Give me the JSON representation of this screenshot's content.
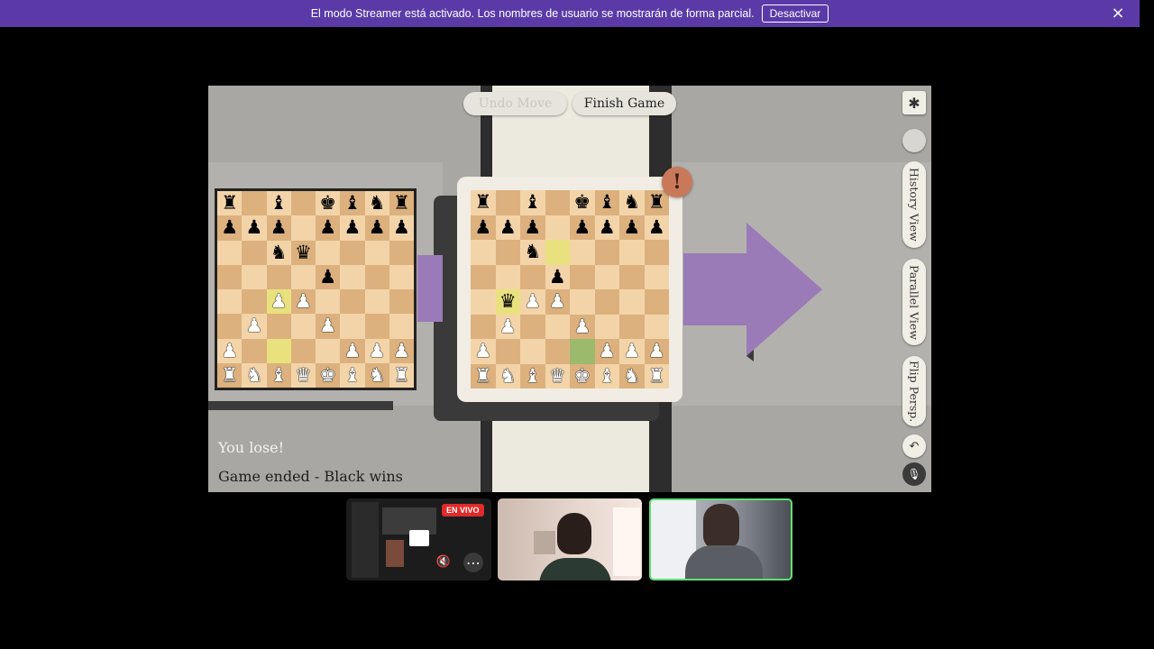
{
  "banner": {
    "text": "El modo Streamer está activado. Los nombres de usuario se mostrarán de forma parcial.",
    "button_label": "Desactivar",
    "close_icon": "×"
  },
  "game": {
    "undo_label": "Undo Move",
    "finish_label": "Finish Game",
    "alert_icon": "!",
    "status_lose": "You lose!",
    "status_end": "Game ended - Black wins",
    "side": {
      "settings_icon": "✱",
      "history_view": "History View",
      "parallel_view": "Parallel View",
      "flip_persp": "Flip Persp.",
      "undo_icon": "↶",
      "mic_icon": "🎙"
    },
    "board_left": [
      [
        "r",
        "",
        "b",
        "",
        "k",
        "b",
        "n",
        "r"
      ],
      [
        "p",
        "p",
        "p",
        "",
        "p",
        "p",
        "p",
        "p"
      ],
      [
        "",
        "",
        "n",
        "q",
        "",
        "",
        "",
        ""
      ],
      [
        "",
        "",
        "",
        "",
        "p",
        "",
        "",
        ""
      ],
      [
        "",
        "",
        "P",
        "P",
        "",
        "",
        "",
        ""
      ],
      [
        "",
        "P",
        "",
        "",
        "P",
        "",
        "",
        ""
      ],
      [
        "P",
        "",
        "",
        "",
        "",
        "P",
        "P",
        "P"
      ],
      [
        "R",
        "N",
        "B",
        "Q",
        "K",
        "B",
        "N",
        "R"
      ]
    ],
    "board_left_highlights": [
      [
        4,
        2,
        "y"
      ],
      [
        6,
        2,
        "y"
      ]
    ],
    "board_right": [
      [
        "r",
        "",
        "b",
        "",
        "k",
        "b",
        "n",
        "r"
      ],
      [
        "p",
        "p",
        "p",
        "",
        "p",
        "p",
        "p",
        "p"
      ],
      [
        "",
        "",
        "n",
        "",
        "",
        "",
        "",
        ""
      ],
      [
        "",
        "",
        "",
        "p",
        "",
        "",
        "",
        ""
      ],
      [
        "",
        "q",
        "P",
        "P",
        "",
        "",
        "",
        ""
      ],
      [
        "",
        "P",
        "",
        "",
        "P",
        "",
        "",
        ""
      ],
      [
        "P",
        "",
        "",
        "",
        "",
        "P",
        "P",
        "P"
      ],
      [
        "R",
        "N",
        "B",
        "Q",
        "K",
        "B",
        "N",
        "R"
      ]
    ],
    "board_right_highlights": [
      [
        2,
        3,
        "y"
      ],
      [
        4,
        1,
        "y"
      ],
      [
        6,
        4,
        "g"
      ]
    ]
  },
  "tiles": {
    "live_label": "EN VIVO",
    "screen_icon": "▭",
    "mute_icon": "🔇",
    "more_icon": "⋯"
  },
  "colors": {
    "banner": "#5b3aa8",
    "board_light": "#f3d4a8",
    "board_dark": "#dcb17e",
    "arrow": "#9b7ab8",
    "active_speaker": "#5fe06f"
  }
}
